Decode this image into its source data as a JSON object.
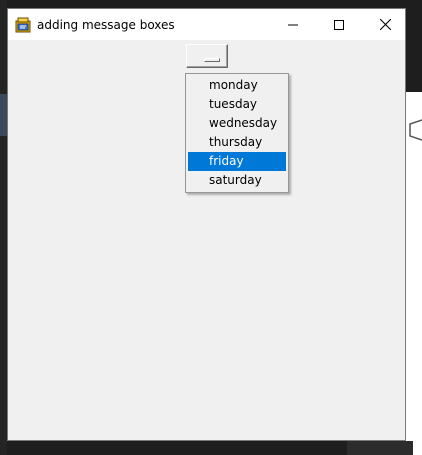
{
  "window": {
    "title": "adding message boxes",
    "controls": {
      "minimize_icon": "minimize-icon",
      "maximize_icon": "maximize-icon",
      "close_icon": "close-icon"
    }
  },
  "option_menu": {
    "selected_value": "",
    "options": [
      {
        "label": "monday",
        "selected": false
      },
      {
        "label": "tuesday",
        "selected": false
      },
      {
        "label": "wednesday",
        "selected": false
      },
      {
        "label": "thursday",
        "selected": false
      },
      {
        "label": "friday",
        "selected": true
      },
      {
        "label": "saturday",
        "selected": false
      }
    ]
  },
  "colors": {
    "selection_highlight": "#0078d7",
    "window_background": "#f0f0f0",
    "titlebar_background": "#ffffff"
  }
}
